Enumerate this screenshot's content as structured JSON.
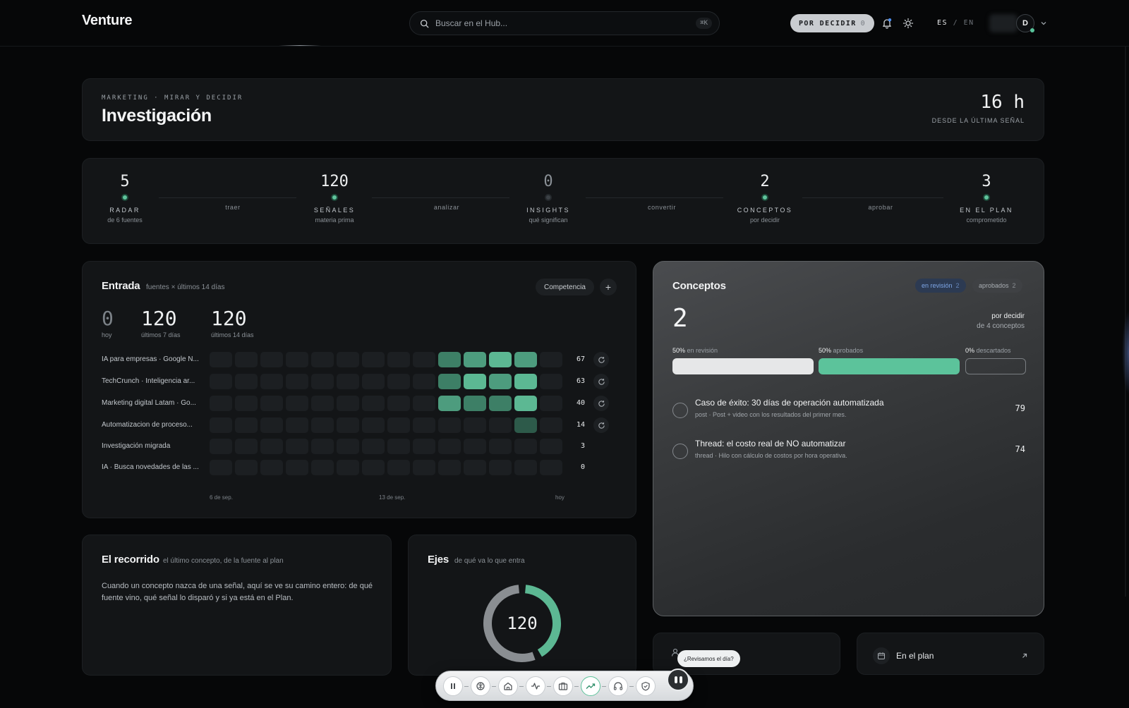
{
  "topbar": {
    "brand": "Venture",
    "search_placeholder": "Buscar en el Hub...",
    "search_shortcut": "⌘K",
    "decide_label": "POR DECIDIR",
    "decide_count": "0",
    "lang_active": "ES",
    "lang_sep": "/",
    "lang_other": "EN",
    "avatar_initial": "D"
  },
  "hero": {
    "crumb": "MARKETING · MIRAR Y DECIDIR",
    "title": "Investigación",
    "since_value": "16 h",
    "since_label": "DESDE LA ÚLTIMA SEÑAL"
  },
  "pipeline": {
    "stages": [
      {
        "num": "5",
        "label": "RADAR",
        "caption": "de 6 fuentes",
        "active": true
      },
      {
        "num": "120",
        "label": "SEÑALES",
        "caption": "materia prima",
        "active": true
      },
      {
        "num": "0",
        "label": "INSIGHTS",
        "caption": "qué significan",
        "active": false
      },
      {
        "num": "2",
        "label": "CONCEPTOS",
        "caption": "por decidir",
        "active": true
      },
      {
        "num": "3",
        "label": "EN EL PLAN",
        "caption": "comprometido",
        "active": true
      }
    ],
    "connectors": [
      "traer",
      "analizar",
      "convertir",
      "aprobar"
    ]
  },
  "entrada": {
    "title": "Entrada",
    "subtitle": "fuentes × últimos 14 días",
    "filter_chip": "Competencia",
    "add_label": "+",
    "stats": [
      {
        "value": "0",
        "label": "hoy"
      },
      {
        "value": "120",
        "label": "últimos 7 días"
      },
      {
        "value": "120",
        "label": "últimos 14 días"
      }
    ],
    "rows": [
      {
        "name": "IA para empresas · Google N...",
        "count": "67",
        "levels": [
          0,
          0,
          0,
          0,
          0,
          0,
          0,
          0,
          0,
          2,
          3,
          4,
          3,
          0
        ],
        "sync": true
      },
      {
        "name": "TechCrunch · Inteligencia ar...",
        "count": "63",
        "levels": [
          0,
          0,
          0,
          0,
          0,
          0,
          0,
          0,
          0,
          2,
          4,
          3,
          4,
          0
        ],
        "sync": true
      },
      {
        "name": "Marketing digital Latam · Go...",
        "count": "40",
        "levels": [
          0,
          0,
          0,
          0,
          0,
          0,
          0,
          0,
          0,
          3,
          2,
          2,
          4,
          0
        ],
        "sync": true
      },
      {
        "name": "Automatizacion de proceso...",
        "count": "14",
        "levels": [
          0,
          0,
          0,
          0,
          0,
          0,
          0,
          0,
          0,
          0,
          0,
          0,
          1,
          0
        ],
        "sync": true
      },
      {
        "name": "Investigación migrada",
        "count": "3",
        "levels": [
          0,
          0,
          0,
          0,
          0,
          0,
          0,
          0,
          0,
          0,
          0,
          0,
          0,
          0
        ],
        "sync": false
      },
      {
        "name": "IA · Busca novedades de las ...",
        "count": "0",
        "levels": [
          0,
          0,
          0,
          0,
          0,
          0,
          0,
          0,
          0,
          0,
          0,
          0,
          0,
          0
        ],
        "sync": false
      }
    ],
    "axis": [
      "6 de sep.",
      "13 de sep.",
      "hoy"
    ]
  },
  "conceptos": {
    "title": "Conceptos",
    "tab_review": "en revisión",
    "tab_review_count": "2",
    "tab_approved": "aprobados",
    "tab_approved_count": "2",
    "count": "2",
    "right_line1": "por decidir",
    "right_line2": "de 4 conceptos",
    "segments": [
      {
        "pct": "50%",
        "label": "en revisión",
        "fraction": 0.5,
        "color": "#e6e7e8"
      },
      {
        "pct": "50%",
        "label": "aprobados",
        "fraction": 0.5,
        "color": "#5cc39b"
      },
      {
        "pct": "0%",
        "label": "descartados",
        "fraction": 0.0,
        "color": "transparent"
      }
    ],
    "items": [
      {
        "title": "Caso de éxito: 30 días de operación automatizada",
        "desc": "post · Post + video con los resultados del primer mes.",
        "score": "79"
      },
      {
        "title": "Thread: el costo real de NO automatizar",
        "desc": "thread · Hilo con cálculo de costos por hora operativa.",
        "score": "74"
      }
    ]
  },
  "recorrido": {
    "title": "El recorrido",
    "subtitle": "el último concepto, de la fuente al plan",
    "body": "Cuando un concepto nazca de una señal, aquí se ve su camino entero: de qué fuente vino, qué señal lo disparó y si ya está en el Plan."
  },
  "ejes": {
    "title": "Ejes",
    "subtitle": "de qué va lo que entra",
    "center": "120",
    "donut": [
      {
        "fraction": 0.43,
        "color": "#5cb893"
      },
      {
        "fraction": 0.57,
        "color": "#8a8e92"
      }
    ]
  },
  "plan_card": {
    "label": "En el plan"
  },
  "assistant": {
    "bubble": "¿Revisamos el día?"
  },
  "dock": {
    "items": [
      "pause-icon",
      "brain-icon",
      "home-icon",
      "pulse-icon",
      "briefcase-icon",
      "trend-icon",
      "headphones-icon",
      "shield-icon"
    ],
    "active_index": 5
  }
}
